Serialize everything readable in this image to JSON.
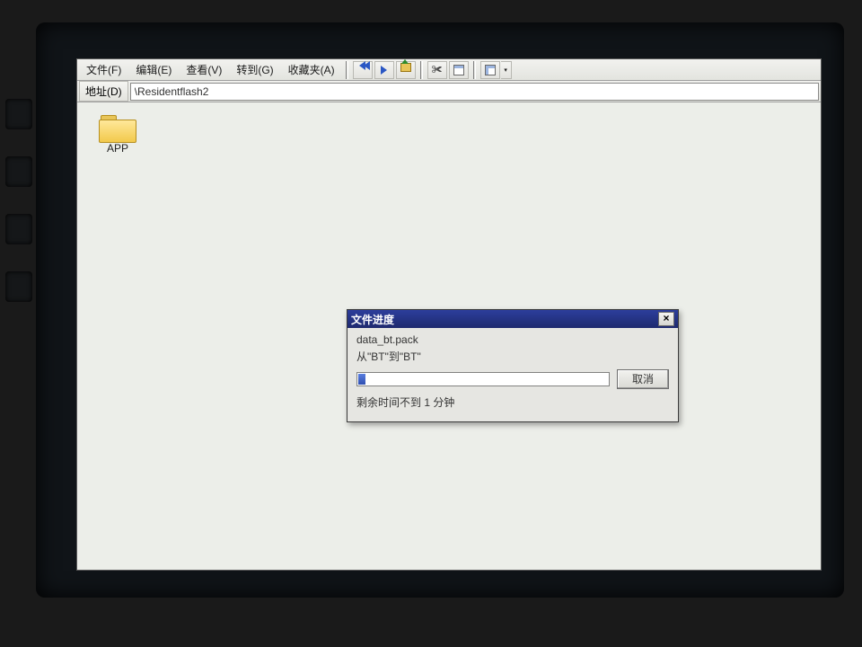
{
  "menu": {
    "file": "文件(F)",
    "edit": "编辑(E)",
    "view": "查看(V)",
    "go": "转到(G)",
    "favorites": "收藏夹(A)"
  },
  "toolbar": {
    "back": "nav-back-icon",
    "fwd": "nav-forward-icon",
    "up": "folder-up-icon",
    "cut": "cut-icon",
    "props": "properties-icon",
    "views": "views-icon"
  },
  "address": {
    "label": "地址(D)",
    "path": "\\Residentflash2"
  },
  "files": [
    {
      "name": "APP",
      "type": "folder"
    }
  ],
  "dialog": {
    "title": "文件进度",
    "filename": "data_bt.pack",
    "fromto": "从\"BT\"到\"BT\"",
    "progress_percent": 3,
    "cancel": "取消",
    "remaining": "剩余时间不到 1 分钟"
  }
}
